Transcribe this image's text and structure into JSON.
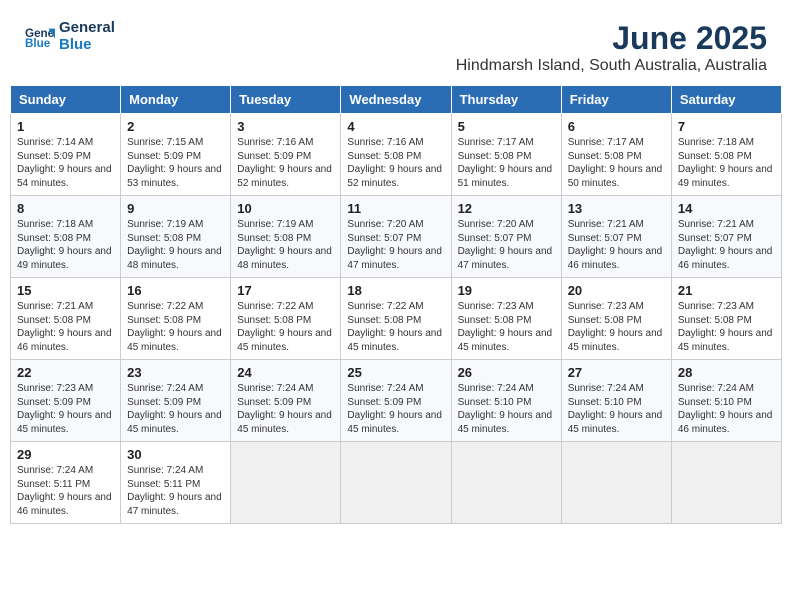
{
  "header": {
    "logo_general": "General",
    "logo_blue": "Blue",
    "title": "June 2025",
    "subtitle": "Hindmarsh Island, South Australia, Australia"
  },
  "weekdays": [
    "Sunday",
    "Monday",
    "Tuesday",
    "Wednesday",
    "Thursday",
    "Friday",
    "Saturday"
  ],
  "weeks": [
    [
      {
        "day": "1",
        "sunrise": "7:14 AM",
        "sunset": "5:09 PM",
        "daylight": "9 hours and 54 minutes."
      },
      {
        "day": "2",
        "sunrise": "7:15 AM",
        "sunset": "5:09 PM",
        "daylight": "9 hours and 53 minutes."
      },
      {
        "day": "3",
        "sunrise": "7:16 AM",
        "sunset": "5:09 PM",
        "daylight": "9 hours and 52 minutes."
      },
      {
        "day": "4",
        "sunrise": "7:16 AM",
        "sunset": "5:08 PM",
        "daylight": "9 hours and 52 minutes."
      },
      {
        "day": "5",
        "sunrise": "7:17 AM",
        "sunset": "5:08 PM",
        "daylight": "9 hours and 51 minutes."
      },
      {
        "day": "6",
        "sunrise": "7:17 AM",
        "sunset": "5:08 PM",
        "daylight": "9 hours and 50 minutes."
      },
      {
        "day": "7",
        "sunrise": "7:18 AM",
        "sunset": "5:08 PM",
        "daylight": "9 hours and 49 minutes."
      }
    ],
    [
      {
        "day": "8",
        "sunrise": "7:18 AM",
        "sunset": "5:08 PM",
        "daylight": "9 hours and 49 minutes."
      },
      {
        "day": "9",
        "sunrise": "7:19 AM",
        "sunset": "5:08 PM",
        "daylight": "9 hours and 48 minutes."
      },
      {
        "day": "10",
        "sunrise": "7:19 AM",
        "sunset": "5:08 PM",
        "daylight": "9 hours and 48 minutes."
      },
      {
        "day": "11",
        "sunrise": "7:20 AM",
        "sunset": "5:07 PM",
        "daylight": "9 hours and 47 minutes."
      },
      {
        "day": "12",
        "sunrise": "7:20 AM",
        "sunset": "5:07 PM",
        "daylight": "9 hours and 47 minutes."
      },
      {
        "day": "13",
        "sunrise": "7:21 AM",
        "sunset": "5:07 PM",
        "daylight": "9 hours and 46 minutes."
      },
      {
        "day": "14",
        "sunrise": "7:21 AM",
        "sunset": "5:07 PM",
        "daylight": "9 hours and 46 minutes."
      }
    ],
    [
      {
        "day": "15",
        "sunrise": "7:21 AM",
        "sunset": "5:08 PM",
        "daylight": "9 hours and 46 minutes."
      },
      {
        "day": "16",
        "sunrise": "7:22 AM",
        "sunset": "5:08 PM",
        "daylight": "9 hours and 45 minutes."
      },
      {
        "day": "17",
        "sunrise": "7:22 AM",
        "sunset": "5:08 PM",
        "daylight": "9 hours and 45 minutes."
      },
      {
        "day": "18",
        "sunrise": "7:22 AM",
        "sunset": "5:08 PM",
        "daylight": "9 hours and 45 minutes."
      },
      {
        "day": "19",
        "sunrise": "7:23 AM",
        "sunset": "5:08 PM",
        "daylight": "9 hours and 45 minutes."
      },
      {
        "day": "20",
        "sunrise": "7:23 AM",
        "sunset": "5:08 PM",
        "daylight": "9 hours and 45 minutes."
      },
      {
        "day": "21",
        "sunrise": "7:23 AM",
        "sunset": "5:08 PM",
        "daylight": "9 hours and 45 minutes."
      }
    ],
    [
      {
        "day": "22",
        "sunrise": "7:23 AM",
        "sunset": "5:09 PM",
        "daylight": "9 hours and 45 minutes."
      },
      {
        "day": "23",
        "sunrise": "7:24 AM",
        "sunset": "5:09 PM",
        "daylight": "9 hours and 45 minutes."
      },
      {
        "day": "24",
        "sunrise": "7:24 AM",
        "sunset": "5:09 PM",
        "daylight": "9 hours and 45 minutes."
      },
      {
        "day": "25",
        "sunrise": "7:24 AM",
        "sunset": "5:09 PM",
        "daylight": "9 hours and 45 minutes."
      },
      {
        "day": "26",
        "sunrise": "7:24 AM",
        "sunset": "5:10 PM",
        "daylight": "9 hours and 45 minutes."
      },
      {
        "day": "27",
        "sunrise": "7:24 AM",
        "sunset": "5:10 PM",
        "daylight": "9 hours and 45 minutes."
      },
      {
        "day": "28",
        "sunrise": "7:24 AM",
        "sunset": "5:10 PM",
        "daylight": "9 hours and 46 minutes."
      }
    ],
    [
      {
        "day": "29",
        "sunrise": "7:24 AM",
        "sunset": "5:11 PM",
        "daylight": "9 hours and 46 minutes."
      },
      {
        "day": "30",
        "sunrise": "7:24 AM",
        "sunset": "5:11 PM",
        "daylight": "9 hours and 47 minutes."
      },
      null,
      null,
      null,
      null,
      null
    ]
  ]
}
